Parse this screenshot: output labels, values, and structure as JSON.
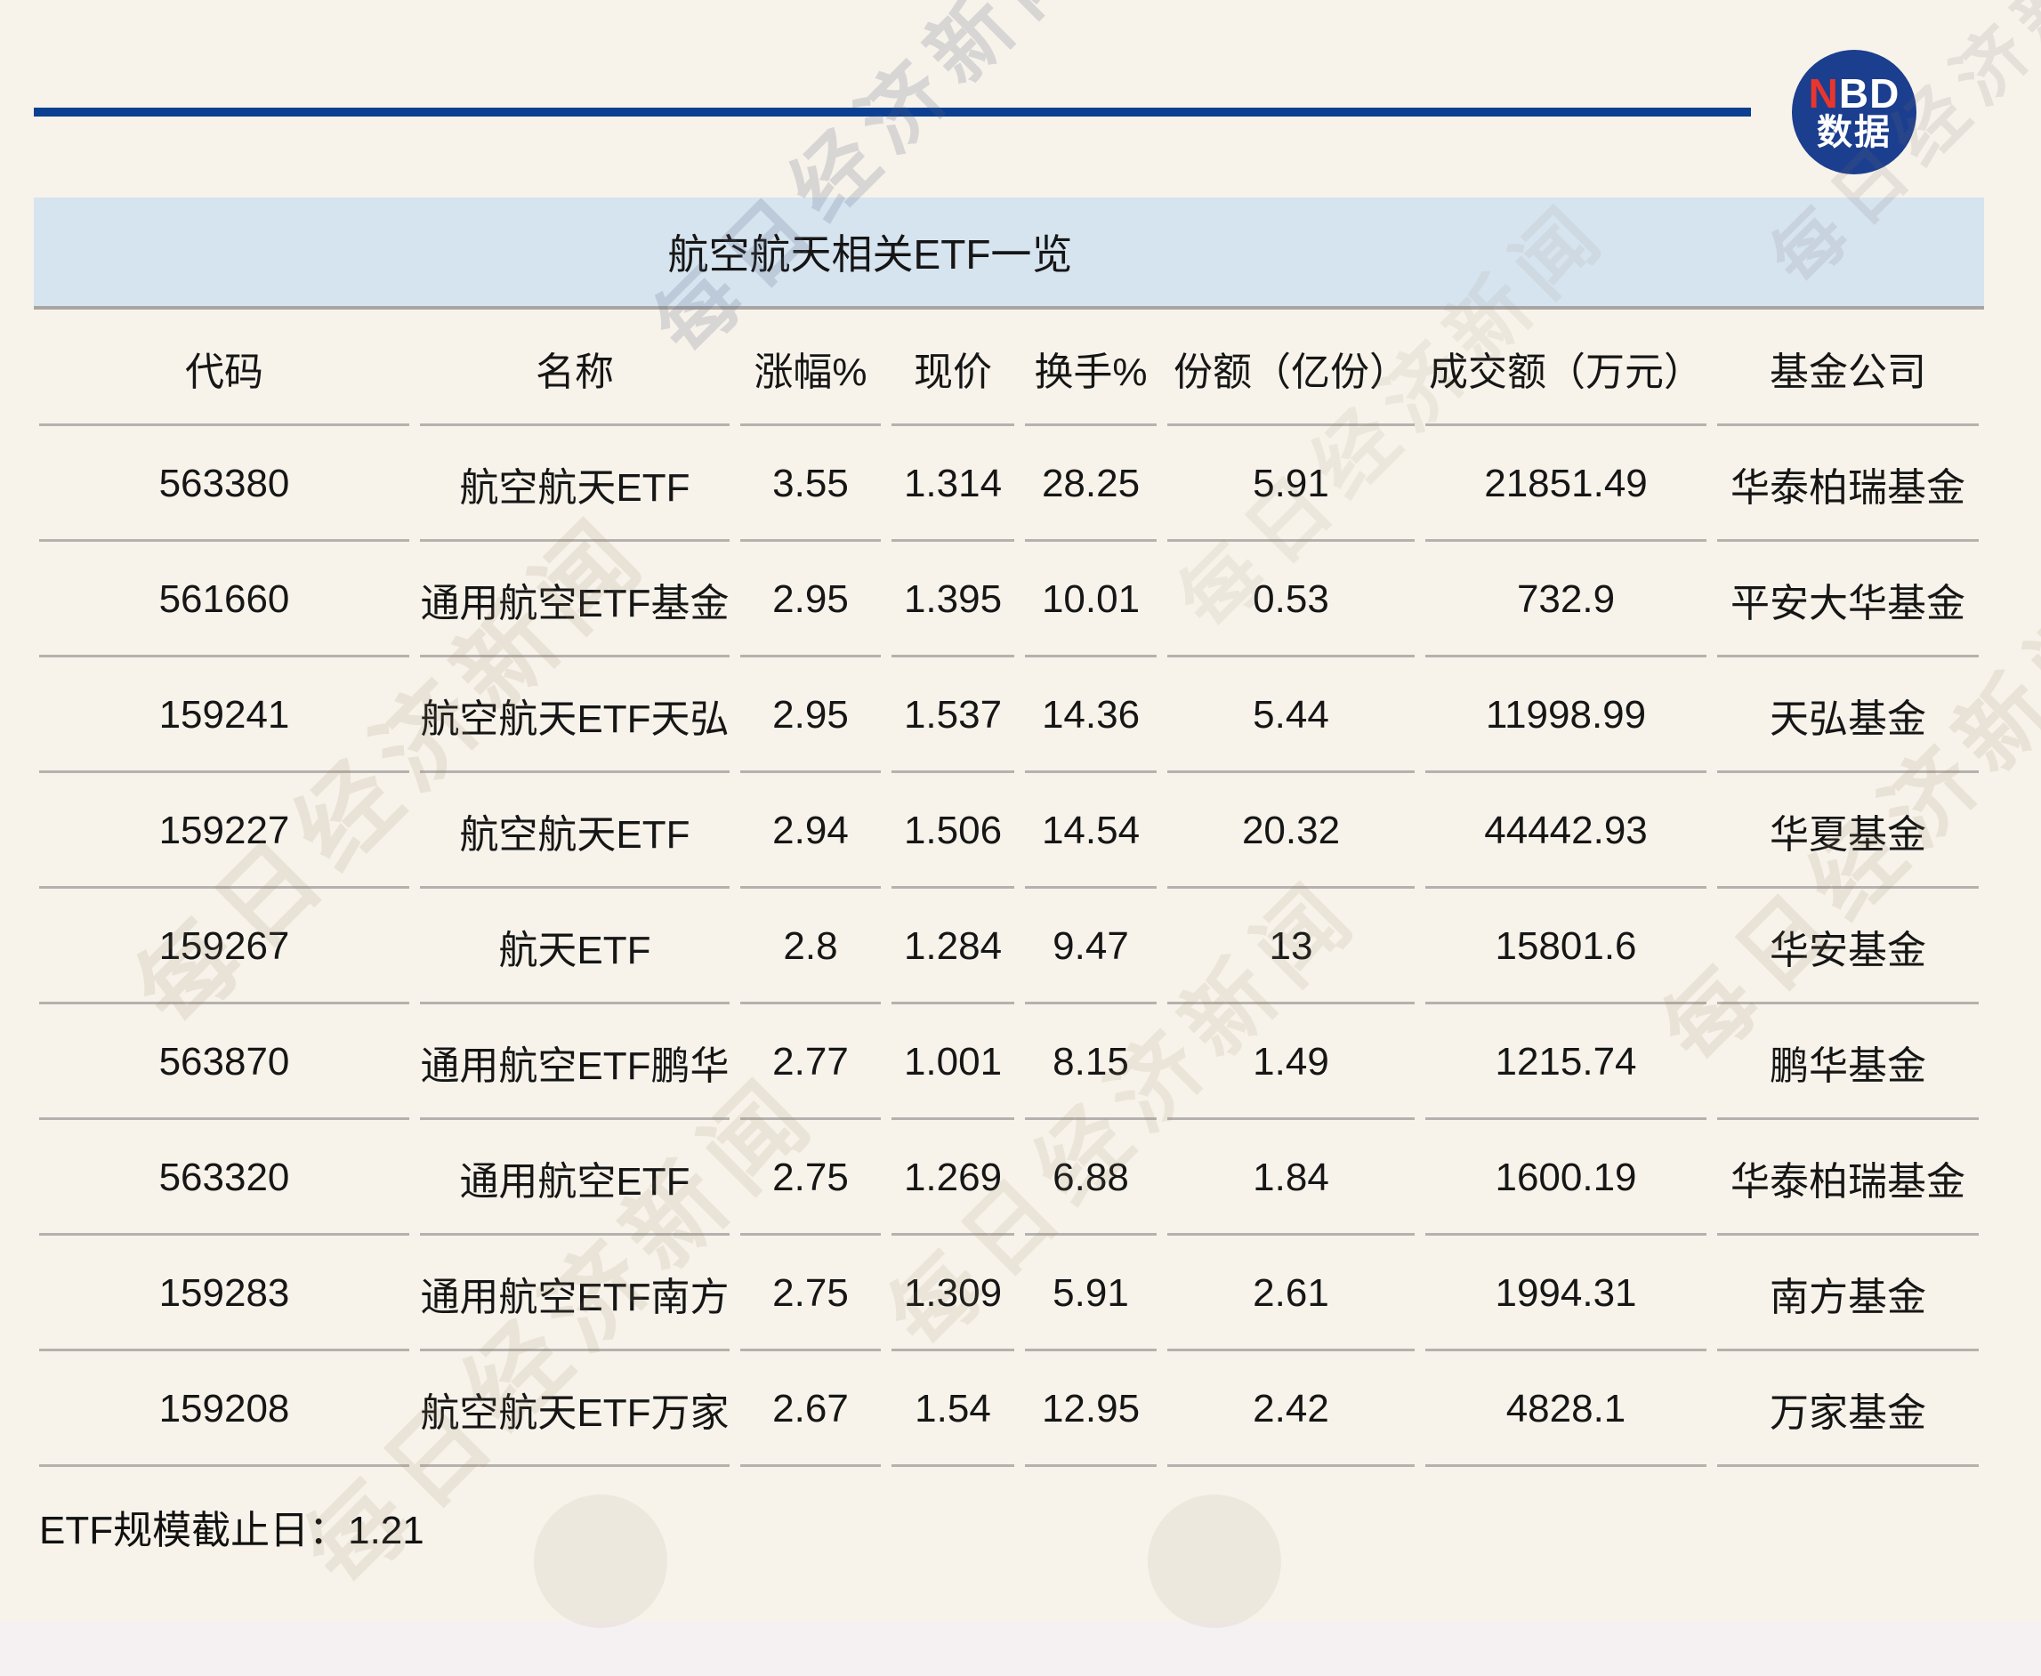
{
  "brand": {
    "logo_n": "N",
    "logo_bd": "BD",
    "logo_cn": "数据",
    "accent_blue": "#0c3f92",
    "logo_bg_blue": "#1b3e8e",
    "logo_red": "#e8362e",
    "title_band_blue": "#d6e4f0",
    "page_background": "#f7f3ea"
  },
  "title": "航空航天相关ETF一览",
  "watermark": {
    "text": "每日经济新闻"
  },
  "footer": {
    "note": "ETF规模截止日：1.21"
  },
  "chart_data": {
    "type": "table",
    "title": "航空航天相关ETF一览",
    "columns": [
      "代码",
      "名称",
      "涨幅%",
      "现价",
      "换手%",
      "份额（亿份）",
      "成交额（万元）",
      "基金公司"
    ],
    "rows": [
      [
        "563380",
        "航空航天ETF",
        "3.55",
        "1.314",
        "28.25",
        "5.91",
        "21851.49",
        "华泰柏瑞基金"
      ],
      [
        "561660",
        "通用航空ETF基金",
        "2.95",
        "1.395",
        "10.01",
        "0.53",
        "732.9",
        "平安大华基金"
      ],
      [
        "159241",
        "航空航天ETF天弘",
        "2.95",
        "1.537",
        "14.36",
        "5.44",
        "11998.99",
        "天弘基金"
      ],
      [
        "159227",
        "航空航天ETF",
        "2.94",
        "1.506",
        "14.54",
        "20.32",
        "44442.93",
        "华夏基金"
      ],
      [
        "159267",
        "航天ETF",
        "2.8",
        "1.284",
        "9.47",
        "13",
        "15801.6",
        "华安基金"
      ],
      [
        "563870",
        "通用航空ETF鹏华",
        "2.77",
        "1.001",
        "8.15",
        "1.49",
        "1215.74",
        "鹏华基金"
      ],
      [
        "563320",
        "通用航空ETF",
        "2.75",
        "1.269",
        "6.88",
        "1.84",
        "1600.19",
        "华泰柏瑞基金"
      ],
      [
        "159283",
        "通用航空ETF南方",
        "2.75",
        "1.309",
        "5.91",
        "2.61",
        "1994.31",
        "南方基金"
      ],
      [
        "159208",
        "航空航天ETF万家",
        "2.67",
        "1.54",
        "12.95",
        "2.42",
        "4828.1",
        "万家基金"
      ]
    ],
    "note": "ETF规模截止日：1.21",
    "layout": {
      "grid": "horizontal row dividers only",
      "legend": "none"
    }
  }
}
